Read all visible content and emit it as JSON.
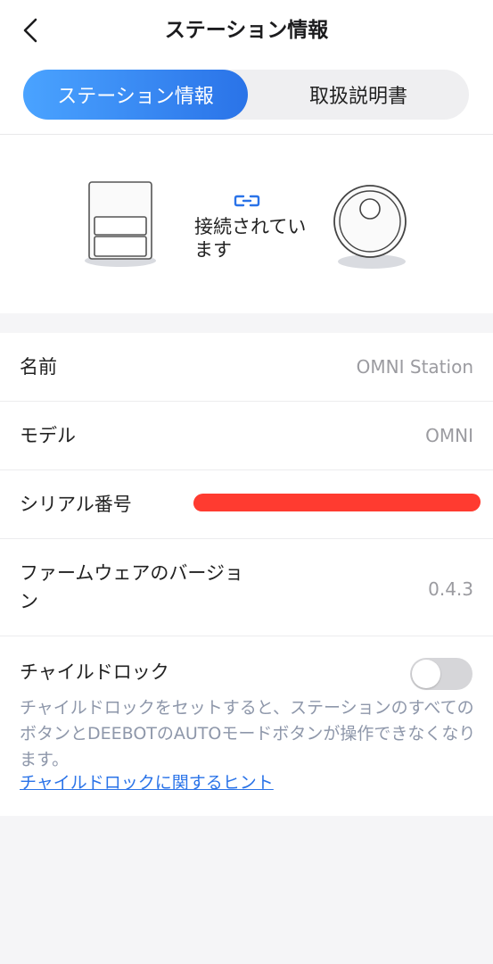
{
  "header": {
    "title": "ステーション情報",
    "tabs": [
      {
        "label": "ステーション情報",
        "active": true
      },
      {
        "label": "取扱説明書",
        "active": false
      }
    ]
  },
  "connection": {
    "status_text": "接続されています"
  },
  "info": {
    "name_label": "名前",
    "name_value": "OMNI Station",
    "model_label": "モデル",
    "model_value": "OMNI",
    "serial_label": "シリアル番号",
    "firmware_label": "ファームウェアのバージョン",
    "firmware_value": "0.4.3",
    "child_lock_label": "チャイルドロック",
    "child_lock_enabled": false,
    "child_lock_description": "チャイルドロックをセットすると、ステーションのすべてのボタンとDEEBOTのAUTOモードボタンが操作できなくなります。",
    "child_lock_hint_link": "チャイルドロックに関するヒント"
  },
  "colors": {
    "accent": "#2a73e8",
    "redaction": "#ff3b30"
  }
}
